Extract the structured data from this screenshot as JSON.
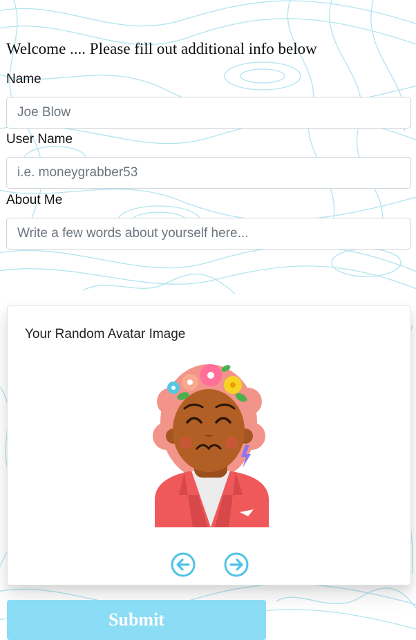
{
  "welcome_heading": "Welcome .... Please fill out additional info below",
  "form": {
    "name_label": "Name",
    "name_placeholder": "Joe Blow",
    "username_label": "User Name",
    "username_placeholder": "i.e. moneygrabber53",
    "about_label": "About Me",
    "about_placeholder": "Write a few words about yourself here..."
  },
  "avatar_card": {
    "title": "Your Random Avatar Image",
    "prev_icon": "arrow-left-circle-icon",
    "next_icon": "arrow-right-circle-icon",
    "arrow_color": "#4cc4e7"
  },
  "submit_label": "Submit",
  "colors": {
    "topo_lines": "#a9e1ef",
    "submit_bg": "#8bdcf5",
    "blazer": "#f0595a",
    "skin": "#b25f25",
    "hair": "#f2948a"
  }
}
